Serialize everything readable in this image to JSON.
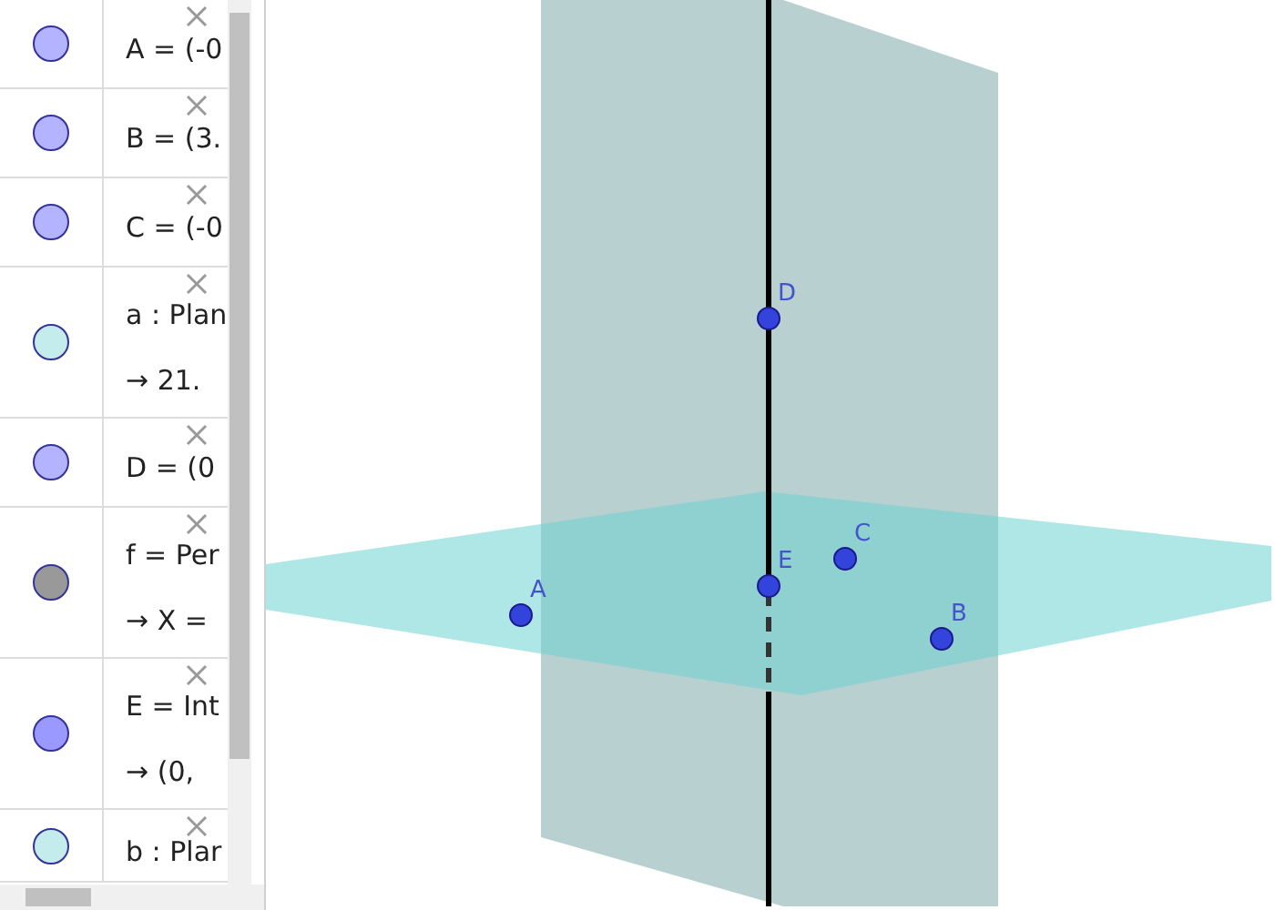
{
  "algebra_view": {
    "rows": [
      {
        "color": "#b3b3ff",
        "lines": [
          "A = (-0"
        ]
      },
      {
        "color": "#b3b3ff",
        "lines": [
          "B = (3."
        ]
      },
      {
        "color": "#b3b3ff",
        "lines": [
          "C = (-0"
        ]
      },
      {
        "color": "#c5ecec",
        "lines": [
          "a : Plan",
          "→ 21."
        ]
      },
      {
        "color": "#b3b3ff",
        "lines": [
          "D = (0"
        ]
      },
      {
        "color": "#999999",
        "lines": [
          "f = Per",
          "→ X ="
        ]
      },
      {
        "color": "#9999ff",
        "lines": [
          "E = Int",
          "→ (0,"
        ]
      },
      {
        "color": "#c5ecec",
        "lines": [
          "b : Plar"
        ]
      }
    ]
  },
  "graphics_3d": {
    "points": [
      {
        "label": "A"
      },
      {
        "label": "B"
      },
      {
        "label": "C"
      },
      {
        "label": "D"
      },
      {
        "label": "E"
      }
    ]
  }
}
